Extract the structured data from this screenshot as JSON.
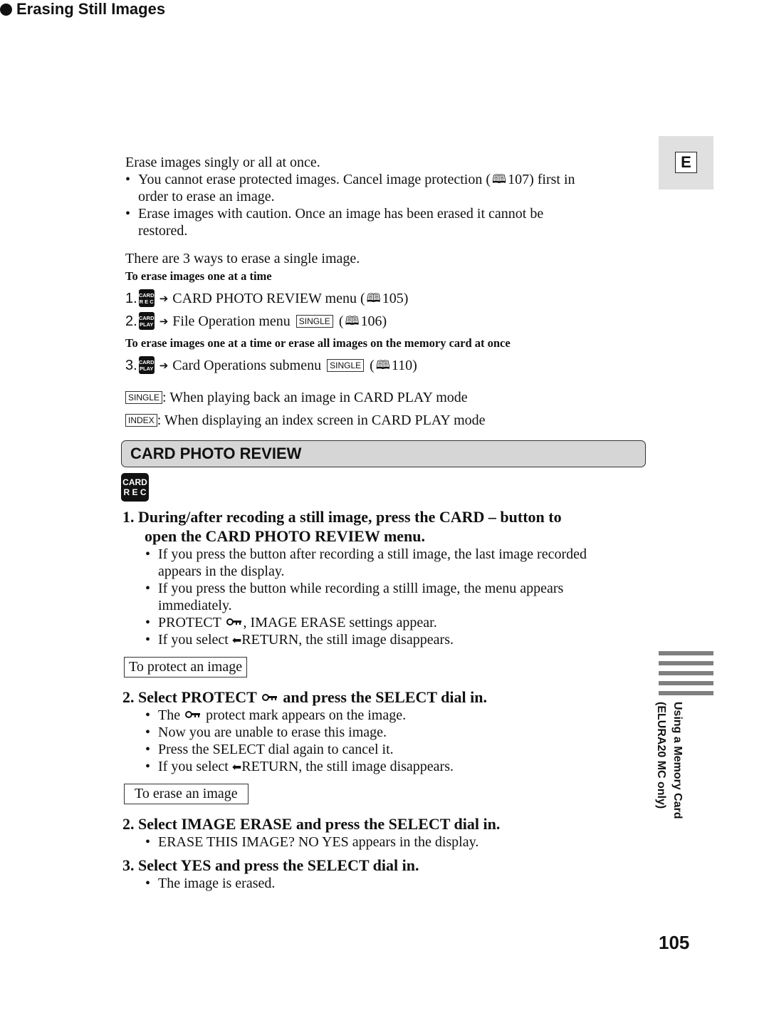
{
  "section": {
    "title": "Erasing Still Images",
    "intro": "Erase images singly or all at once.",
    "bullets": [
      [
        "You cannot erase protected images. Cancel image protection (",
        "107) first in",
        "order to erase an image."
      ],
      [
        "Erase images with caution. Once an image has been erased it cannot be",
        "restored."
      ]
    ],
    "ways_text": "There are 3 ways to erase a single image.",
    "sub1": "To erase images one at a time",
    "steps": [
      {
        "num": "1.",
        "chip_top": "CARD",
        "chip_bottom": "R E C",
        "text": "CARD PHOTO REVIEW menu (",
        "tag": "",
        "ref": "105)"
      },
      {
        "num": "2.",
        "chip_top": "CARD",
        "chip_bottom": "PLAY",
        "text": "File Operation menu",
        "tag": "SINGLE",
        "ref": "106)"
      },
      {
        "num": "3.",
        "chip_top": "CARD",
        "chip_bottom": "PLAY",
        "text": "Card Operations submenu",
        "tag": "SINGLE",
        "ref": "110)"
      }
    ],
    "sub2": "To erase images one at a time or erase all images on the memory card at once",
    "legend": [
      {
        "tag": "SINGLE",
        "text": ": When playing back an image in CARD PLAY mode"
      },
      {
        "tag": "INDEX",
        "text": ": When displaying an index screen in CARD PLAY mode"
      }
    ]
  },
  "banner": {
    "title": "CARD PHOTO REVIEW",
    "chip_top": "CARD",
    "chip_bottom": "R E C"
  },
  "procedure": {
    "step1": {
      "line1": "1.  During/after recoding a still image, press the CARD – button to",
      "line2": "open the CARD PHOTO REVIEW menu.",
      "bullets": [
        [
          "If you press the button after recording a still image, the last image recorded",
          "appears in the display."
        ],
        [
          "If you press the button while recording a stilll image, the menu appears",
          "immediately."
        ],
        [
          "PROTECT",
          ", IMAGE ERASE settings appear."
        ],
        [
          "If you select ",
          "RETURN, the still image disappears."
        ]
      ]
    },
    "protect_label": "To protect an image",
    "step2a": {
      "pre": "2.  Select PROTECT",
      "post": "and press the SELECT dial in.",
      "bullets": [
        [
          "The",
          "protect mark appears on the image."
        ],
        [
          "Now you are unable to erase this image."
        ],
        [
          "Press the SELECT dial again to cancel it."
        ],
        [
          "If you select ",
          "RETURN, the still image disappears."
        ]
      ]
    },
    "erase_label": "To erase an image",
    "step2b": {
      "title": "2.  Select IMAGE ERASE and press the SELECT dial in.",
      "bullets": [
        "ERASE THIS IMAGE? NO YES appears in the display."
      ]
    },
    "step3": {
      "title": "3.  Select YES and press the SELECT dial in.",
      "bullets": [
        "The image is erased."
      ]
    }
  },
  "sidebar": {
    "language_tab": "E",
    "chapter_line1": "Using a Memory Card",
    "chapter_line2": "(ELURA20 MC only)"
  },
  "page_number": "105",
  "icons": {
    "bullet": "•",
    "arrow": "➔",
    "book": "🕮",
    "return": "⬅"
  }
}
